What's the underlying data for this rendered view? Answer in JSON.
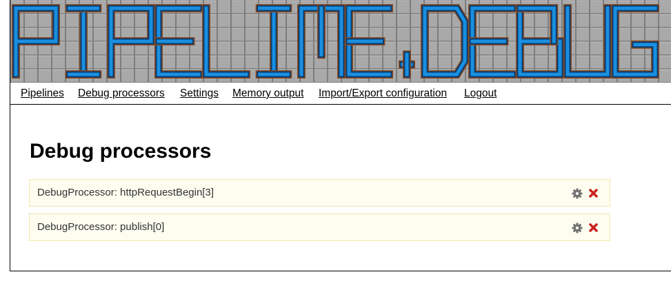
{
  "banner": {
    "title": "PIPELINE.DEBUG"
  },
  "nav": {
    "items": [
      {
        "label": "Pipelines"
      },
      {
        "label": "Debug processors"
      },
      {
        "label": "Settings"
      },
      {
        "label": "Memory output"
      },
      {
        "label": "Import/Export configuration"
      },
      {
        "label": "Logout"
      }
    ]
  },
  "main": {
    "title": "Debug processors",
    "processors": [
      {
        "label": "DebugProcessor: httpRequestBegin[3]",
        "settings_icon": "gear-icon",
        "delete_icon": "close-icon"
      },
      {
        "label": "DebugProcessor: publish[0]",
        "settings_icon": "gear-icon",
        "delete_icon": "close-icon"
      }
    ]
  },
  "colors": {
    "tile": "#a9a9a9",
    "tile_line": "#7d7d7d",
    "pipe": "#1a8fe0",
    "pipe_dark": "#0a3c70",
    "pipe_rust": "#8a4a20",
    "delete": "#cc2222",
    "gear": "#707070"
  }
}
